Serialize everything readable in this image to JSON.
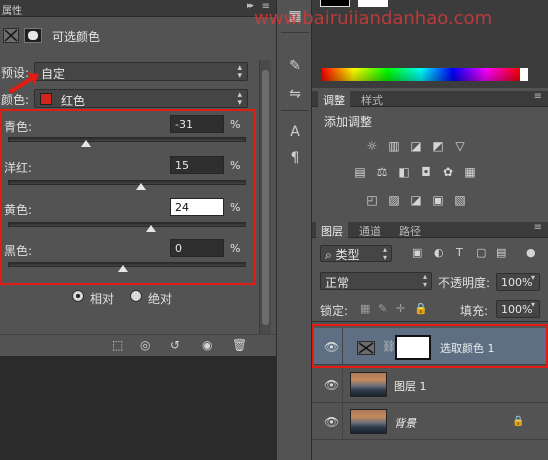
{
  "properties_panel": {
    "title": "属性",
    "adjustment_title": "可选颜色",
    "preset_label": "预设:",
    "preset_value": "自定",
    "colors_label": "颜色:",
    "colors_value": "红色",
    "sliders": [
      {
        "label": "青色:",
        "value": "-31",
        "unit": "%"
      },
      {
        "label": "洋红:",
        "value": "15",
        "unit": "%"
      },
      {
        "label": "黄色:",
        "value": "24",
        "unit": "%"
      },
      {
        "label": "黑色:",
        "value": "0",
        "unit": "%"
      }
    ],
    "method_relative": "相对",
    "method_absolute": "绝对"
  },
  "watermark": "www.bairuiiandanhao.com",
  "adjustments_panel": {
    "tabs": [
      "调整",
      "样式"
    ],
    "add_label": "添加调整"
  },
  "layers_panel": {
    "tabs": [
      "图层",
      "通道",
      "路径"
    ],
    "filter_label": "类型",
    "blend_mode": "正常",
    "opacity_label": "不透明度:",
    "opacity_value": "100%",
    "lock_label": "锁定:",
    "fill_label": "填充:",
    "fill_value": "100%",
    "layers": [
      {
        "name": "选取颜色 1",
        "type": "adjustment",
        "selected": true
      },
      {
        "name": "图层 1",
        "type": "pixel",
        "selected": false
      },
      {
        "name": "背景",
        "type": "background",
        "selected": false
      }
    ]
  },
  "colors": {
    "highlight_red": "#e31b12",
    "selected_layer": "#5e6f84",
    "swatch_red": "#d3251c"
  }
}
